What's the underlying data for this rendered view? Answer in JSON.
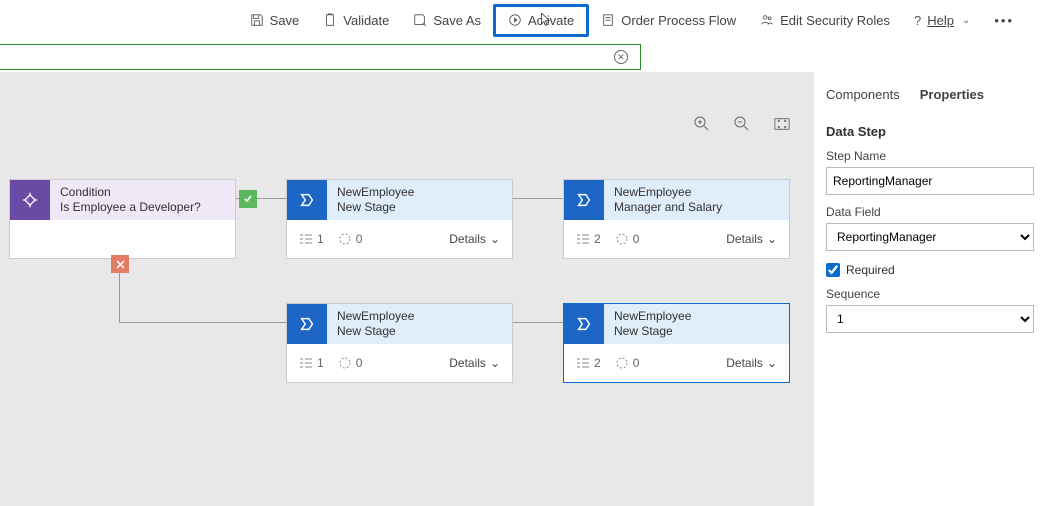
{
  "toolbar": {
    "save": "Save",
    "validate": "Validate",
    "saveAs": "Save As",
    "activate": "Activate",
    "orderProcessFlow": "Order Process Flow",
    "editSecurityRoles": "Edit Security Roles",
    "help": "Help"
  },
  "canvas": {
    "condition": {
      "title": "Condition",
      "subtitle": "Is Employee a Developer?"
    },
    "stages": [
      {
        "entity": "NewEmployee",
        "name": "New Stage",
        "steps": "1",
        "dur": "0",
        "details": "Details"
      },
      {
        "entity": "NewEmployee",
        "name": "Manager and Salary",
        "steps": "2",
        "dur": "0",
        "details": "Details"
      },
      {
        "entity": "NewEmployee",
        "name": "New Stage",
        "steps": "1",
        "dur": "0",
        "details": "Details"
      },
      {
        "entity": "NewEmployee",
        "name": "New Stage",
        "steps": "2",
        "dur": "0",
        "details": "Details"
      }
    ]
  },
  "props": {
    "tabs": {
      "components": "Components",
      "properties": "Properties"
    },
    "section": "Data Step",
    "stepNameLabel": "Step Name",
    "stepNameValue": "ReportingManager",
    "dataFieldLabel": "Data Field",
    "dataFieldValue": "ReportingManager",
    "requiredLabel": "Required",
    "sequenceLabel": "Sequence",
    "sequenceValue": "1"
  }
}
